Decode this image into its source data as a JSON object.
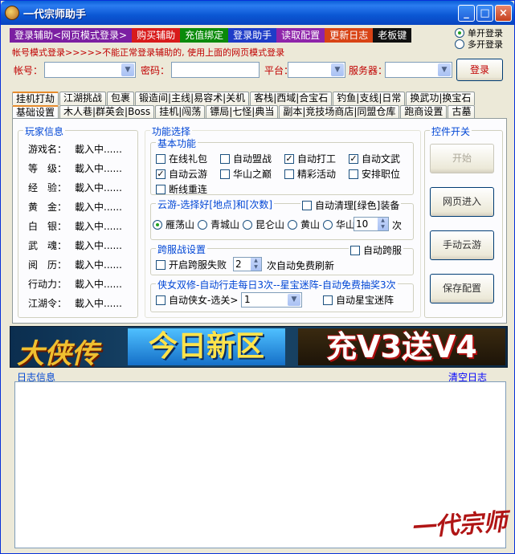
{
  "window": {
    "title": "一代宗师助手"
  },
  "topbar": [
    {
      "label": "登录辅助<网页模式登录>",
      "color": "#7b1fa2"
    },
    {
      "label": "购买辅助",
      "color": "#d81b1b"
    },
    {
      "label": "充值绑定",
      "color": "#0a8a0a"
    },
    {
      "label": "登录助手",
      "color": "#1e3cc8"
    },
    {
      "label": "读取配置",
      "color": "#8e24aa"
    },
    {
      "label": "更新日志",
      "color": "#d84315"
    },
    {
      "label": "老板键",
      "color": "#111111"
    }
  ],
  "login_mode": {
    "single": "单开登录",
    "multi": "多开登录"
  },
  "notice": "帐号模式登录>>>>>不能正常登录辅助的, 使用上面的网页模式登录",
  "login": {
    "account_label": "帐号：",
    "password_label": "密码：",
    "platform_label": "平台：",
    "server_label": "服务器：",
    "login_button": "登录"
  },
  "tabs_row1": [
    "挂机打劫",
    "江湖挑战",
    "包裹",
    "锻造间|主线|易容术|关机",
    "客栈|西域|合宝石",
    "钓鱼|支线|日常",
    "换武功|换宝石"
  ],
  "tabs_row2": [
    "基础设置",
    "木人巷|群英会|Boss",
    "挂机|闯荡",
    "镖局|七怪|典当",
    "副本|竞技场商店|同盟仓库",
    "跑商设置",
    "古墓"
  ],
  "player_info": {
    "title": "玩家信息",
    "rows": [
      {
        "key": "游戏名：",
        "value": "載入中......"
      },
      {
        "key": "等　级：",
        "value": "載入中......"
      },
      {
        "key": "经　验：",
        "value": "載入中......"
      },
      {
        "key": "黄　金：",
        "value": "載入中......"
      },
      {
        "key": "白　银：",
        "value": "載入中......"
      },
      {
        "key": "武　魂：",
        "value": "載入中......"
      },
      {
        "key": "阅　历：",
        "value": "載入中......"
      },
      {
        "key": "行动力：",
        "value": "載入中......"
      },
      {
        "key": "江湖令：",
        "value": "載入中......"
      }
    ]
  },
  "features": {
    "title": "功能选择",
    "basic_title": "基本功能",
    "basic": [
      {
        "label": "在线礼包",
        "checked": false
      },
      {
        "label": "自动盟战",
        "checked": false
      },
      {
        "label": "自动打工",
        "checked": true
      },
      {
        "label": "自动文武",
        "checked": true
      },
      {
        "label": "自动云游",
        "checked": true
      },
      {
        "label": "华山之巅",
        "checked": false
      },
      {
        "label": "精彩活动",
        "checked": false
      },
      {
        "label": "安排职位",
        "checked": false
      },
      {
        "label": "断线重连",
        "checked": false
      }
    ],
    "cloud_title": "云游-选择好[地点]和[次数]",
    "cloud_cleanup": "自动清理[绿色]装备",
    "places": [
      {
        "label": "雁荡山",
        "selected": true
      },
      {
        "label": "青城山",
        "selected": false
      },
      {
        "label": "昆仑山",
        "selected": false
      },
      {
        "label": "黄山",
        "selected": false
      },
      {
        "label": "华山",
        "selected": false
      }
    ],
    "cloud_count": "10",
    "cloud_count_unit": "次",
    "cross_title": "跨服战设置",
    "cross_auto": "自动跨服",
    "cross_fail_label": "开启跨服失败",
    "cross_fail_count": "2",
    "cross_fail_suffix": "次自动免费刷新",
    "hero_title": "侠女双修-自动行走每日3次--星宝迷阵-自动免费抽奖3次",
    "hero_auto": "自动侠女-选关>",
    "hero_level": "1",
    "star_auto": "自动星宝迷阵"
  },
  "controls": {
    "title": "控件开关",
    "start": "开始",
    "web_enter": "网页进入",
    "manual_cloud": "手动云游",
    "save_config": "保存配置"
  },
  "banner": {
    "part1": "大侠传",
    "part2": "今日新区",
    "part3": "充V3送V4"
  },
  "log": {
    "title": "日志信息",
    "clear": "清空日志"
  },
  "signature": "一代宗师"
}
